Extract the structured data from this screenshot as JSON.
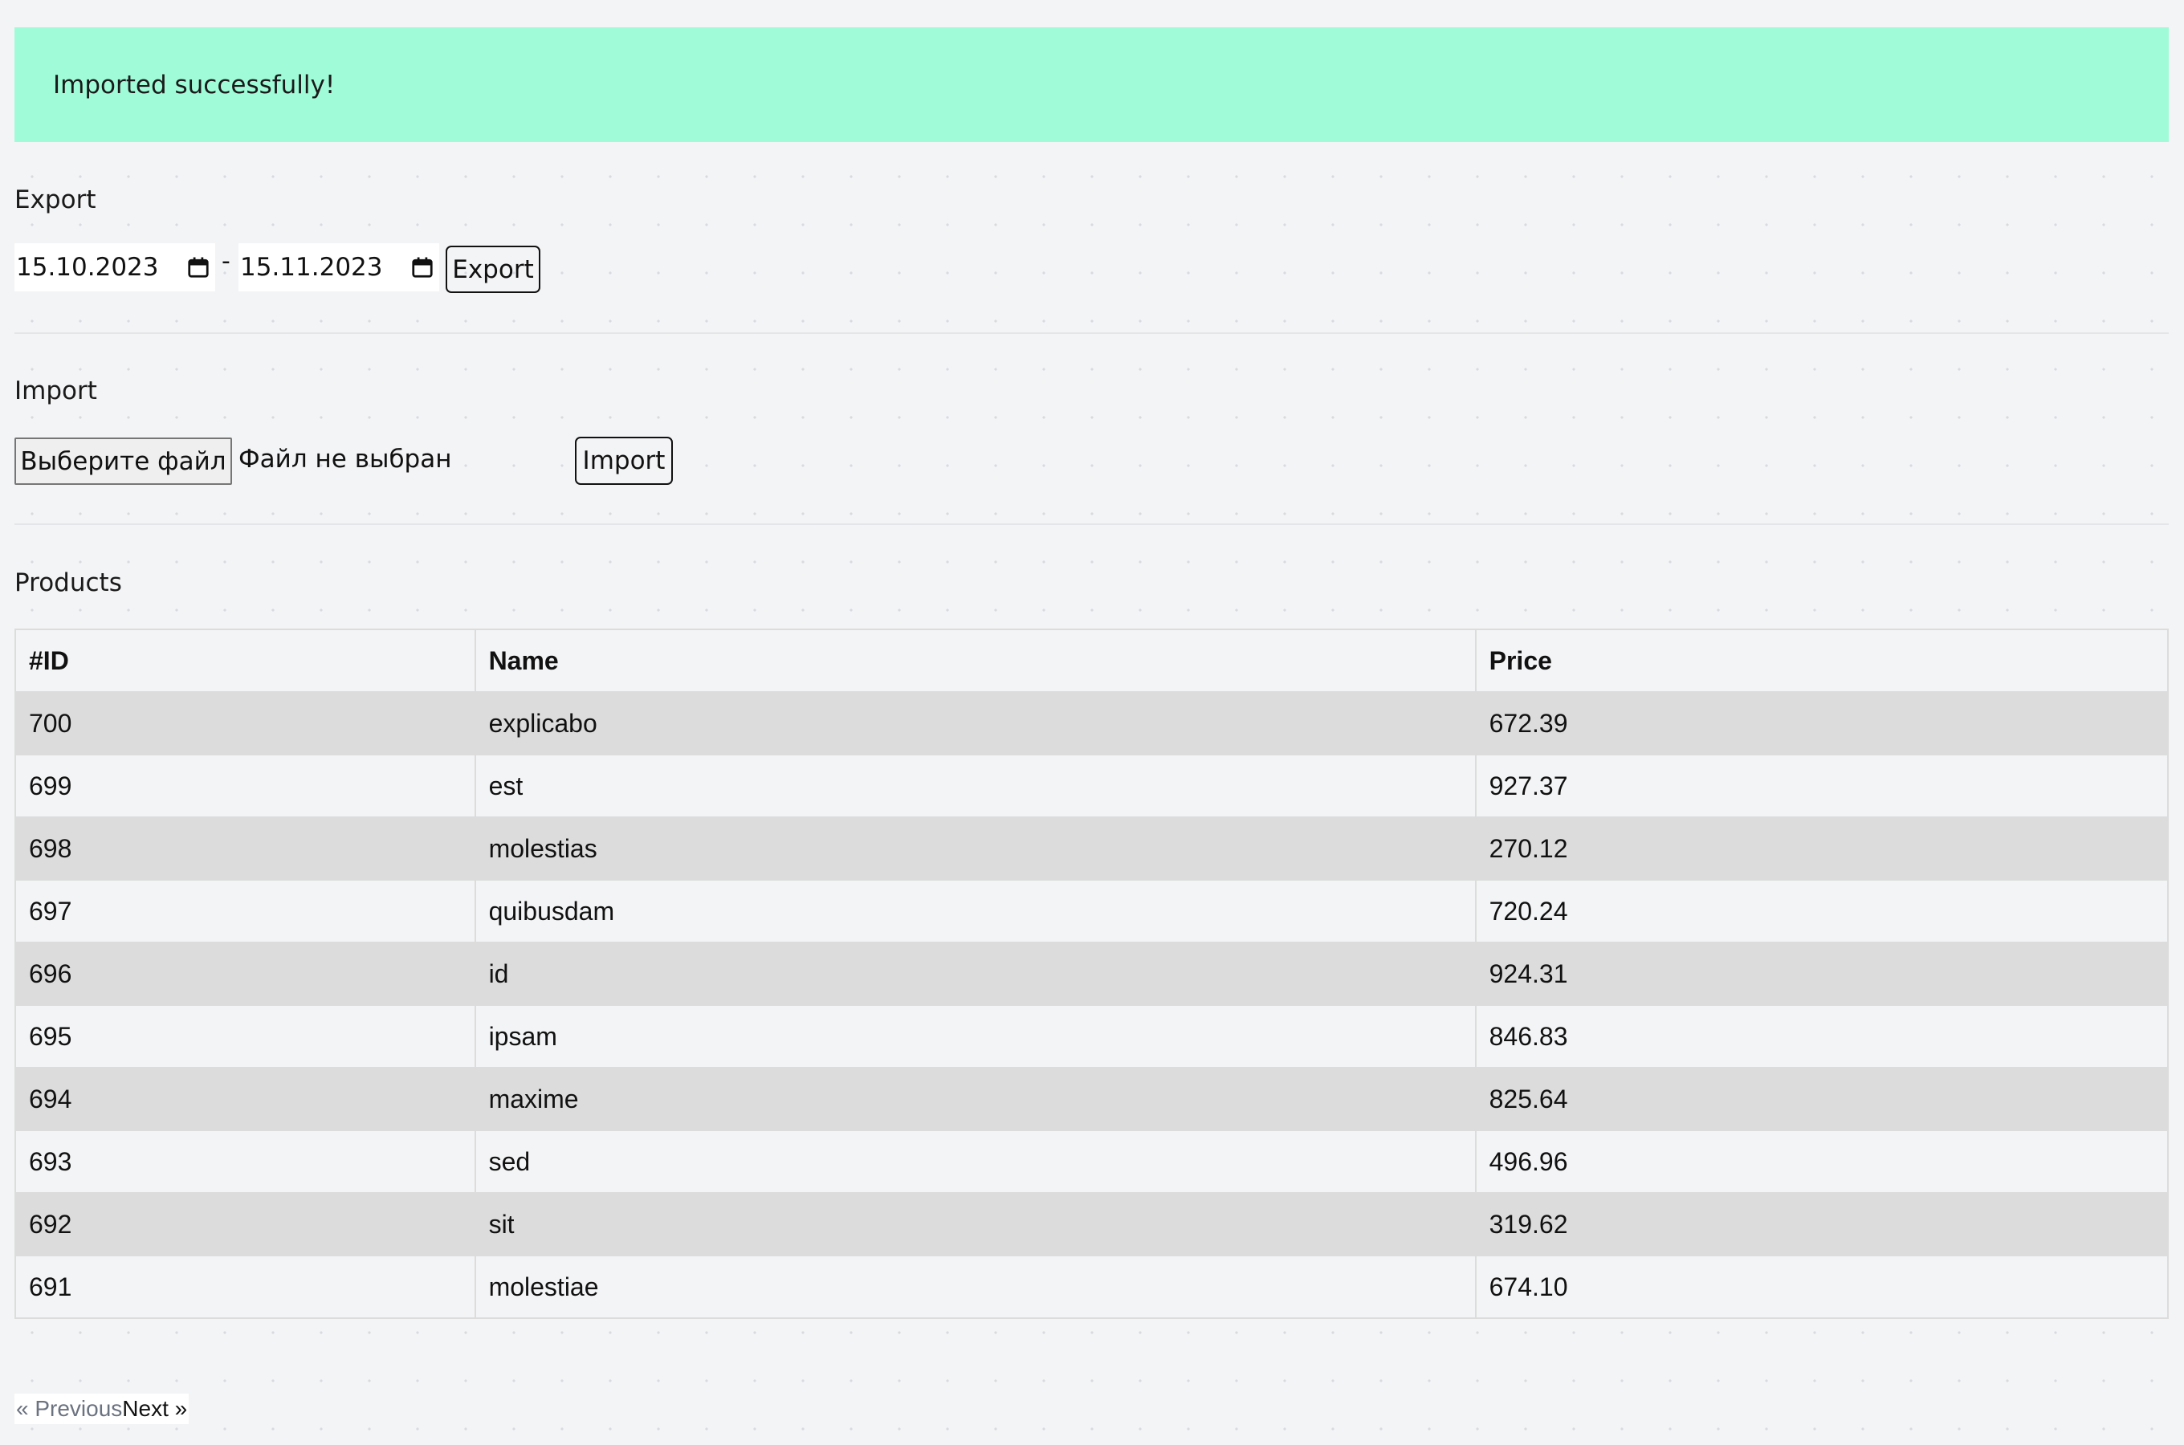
{
  "alert": {
    "message": "Imported successfully!",
    "color": "#a0fcd8"
  },
  "export": {
    "title": "Export",
    "date_from": "15.10.2023",
    "separator": "-",
    "date_to": "15.11.2023",
    "button_label": "Export"
  },
  "import": {
    "title": "Import",
    "choose_file_label": "Выберите файл",
    "file_status": "Файл не выбран",
    "button_label": "Import"
  },
  "products": {
    "title": "Products",
    "columns": [
      "#ID",
      "Name",
      "Price"
    ],
    "rows": [
      {
        "id": "700",
        "name": "explicabo",
        "price": "672.39"
      },
      {
        "id": "699",
        "name": "est",
        "price": "927.37"
      },
      {
        "id": "698",
        "name": "molestias",
        "price": "270.12"
      },
      {
        "id": "697",
        "name": "quibusdam",
        "price": "720.24"
      },
      {
        "id": "696",
        "name": "id",
        "price": "924.31"
      },
      {
        "id": "695",
        "name": "ipsam",
        "price": "846.83"
      },
      {
        "id": "694",
        "name": "maxime",
        "price": "825.64"
      },
      {
        "id": "693",
        "name": "sed",
        "price": "496.96"
      },
      {
        "id": "692",
        "name": "sit",
        "price": "319.62"
      },
      {
        "id": "691",
        "name": "molestiae",
        "price": "674.10"
      }
    ]
  },
  "pagination": {
    "previous_label": "« Previous",
    "next_label": "Next »"
  },
  "icons": {
    "calendar": "calendar-icon"
  }
}
